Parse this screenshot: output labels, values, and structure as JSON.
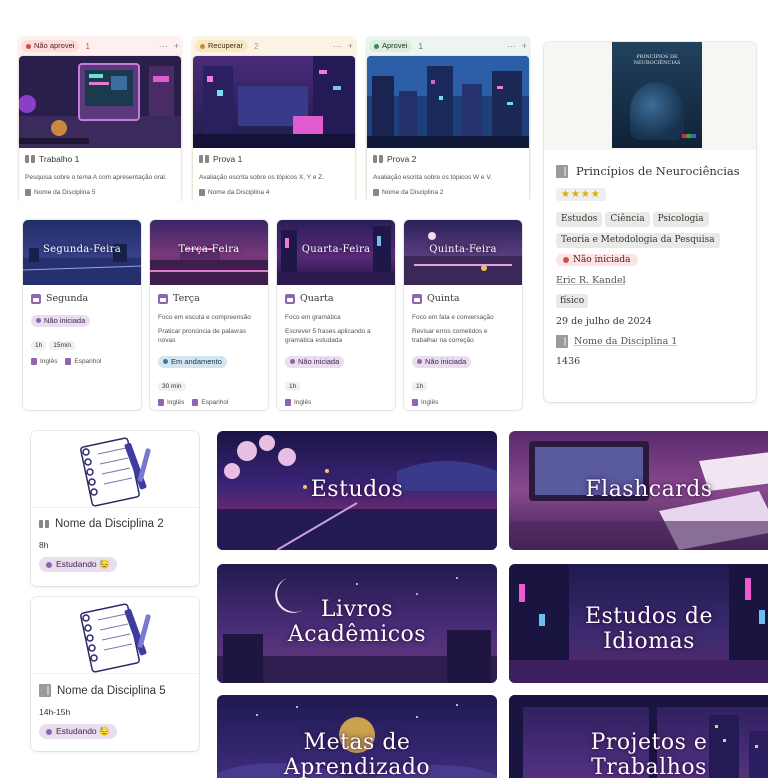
{
  "kanban": [
    {
      "status": "Não aprovei",
      "count": "1",
      "title": "Trabalho 1",
      "description": "Pesquisa sobre o tema A com apresentação oral.",
      "subject": "Nome da Disciplina 5"
    },
    {
      "status": "Recuperar",
      "count": "2",
      "title": "Prova 1",
      "description": "Avaliação escrita sobre os tópicos X, Y e Z.",
      "subject": "Nome da Disciplina 4"
    },
    {
      "status": "Aprovei",
      "count": "1",
      "title": "Prova 2",
      "description": "Avaliação escrita sobre os tópicos W e V.",
      "subject": "Nome da Disciplina 2"
    }
  ],
  "kanban_actions": {
    "more": "···",
    "add": "+"
  },
  "days": [
    {
      "cover_label": "Segunda-Feira",
      "title": "Segunda",
      "status": "Não iniciada",
      "chips": [
        "1h",
        "15min"
      ],
      "languages": [
        "Inglês",
        "Espanhol"
      ]
    },
    {
      "cover_label": "Terça-Feira",
      "title": "Terça",
      "focus": "Foco em escuta e compreensão",
      "task": "Praticar pronúncia de palavras novas",
      "status": "Em andamento",
      "chips": [
        "30 min"
      ],
      "languages": [
        "Inglês",
        "Espanhol"
      ]
    },
    {
      "cover_label": "Quarta-Feira",
      "title": "Quarta",
      "focus": "Foco em gramática",
      "task": "Escrever 5 frases aplicando a gramática estudada",
      "status": "Não iniciada",
      "chips": [
        "1h"
      ],
      "languages": [
        "Inglês"
      ]
    },
    {
      "cover_label": "Quinta-Feira",
      "title": "Quinta",
      "focus": "Foco em fala e conversação",
      "task": "Revisar erros cometidos e trabalhar na correção",
      "status": "Não iniciada",
      "chips": [
        "1h"
      ],
      "languages": [
        "Inglês"
      ]
    }
  ],
  "book": {
    "cover_title": "PRINCÍPIOS DE NEUROCIÊNCIAS",
    "title": "Princípios de Neurociências",
    "rating": "★★★★",
    "tags": [
      "Estudos",
      "Ciência",
      "Psicologia",
      "Teoria e Metodologia da Pesquisa"
    ],
    "status": "Não iniciada",
    "author": "Eric R. Kandel",
    "format": "físico",
    "date": "29 de julho de 2024",
    "subject": "Nome da Disciplina 1",
    "pages": "1436"
  },
  "subjects": [
    {
      "title": "Nome da Disciplina 2",
      "time": "8h",
      "status": "Estudando 😓"
    },
    {
      "title": "Nome da Disciplina 5",
      "time": "14h-15h",
      "status": "Estudando 😓"
    }
  ],
  "tiles": [
    {
      "line1": "Estudos",
      "line2": ""
    },
    {
      "line1": "Flashcards",
      "line2": ""
    },
    {
      "line1": "Livros",
      "line2": "Acadêmicos"
    },
    {
      "line1": "Estudos de",
      "line2": "Idiomas"
    },
    {
      "line1": "Metas de",
      "line2": "Aprendizado"
    },
    {
      "line1": "Projetos e",
      "line2": "Trabalhos"
    }
  ],
  "colors": {
    "purple": "#9065b0",
    "red": "#d44c47",
    "yellow": "#cb912f",
    "green": "#448361"
  }
}
